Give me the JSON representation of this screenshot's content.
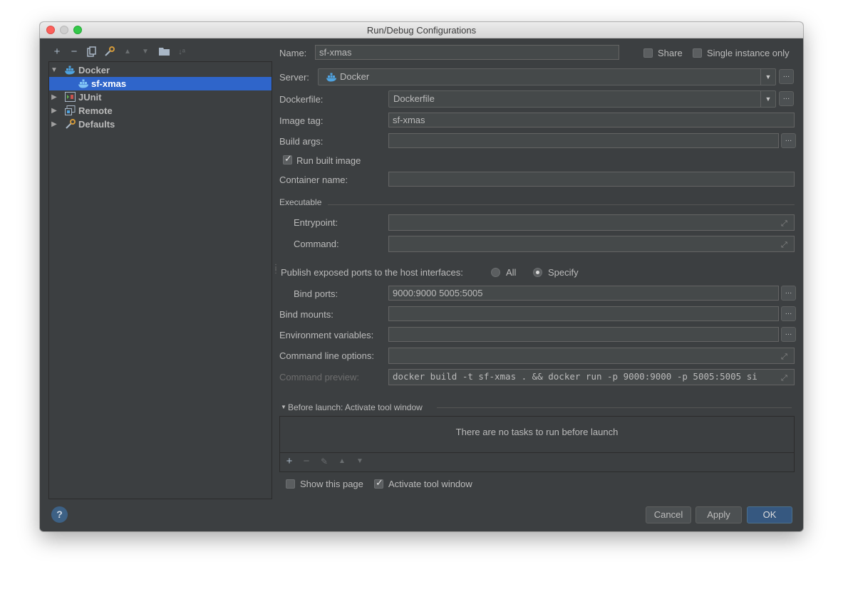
{
  "window": {
    "title": "Run/Debug Configurations"
  },
  "toolbar": {
    "icons": [
      "add-icon",
      "remove-icon",
      "copy-icon",
      "edit-defaults-icon",
      "move-up-icon",
      "move-down-icon",
      "folder-icon",
      "sort-icon"
    ]
  },
  "tree": {
    "items": [
      {
        "label": "Docker",
        "icon": "docker-icon",
        "expanded": true
      },
      {
        "label": "sf-xmas",
        "icon": "docker-icon",
        "selected": true
      },
      {
        "label": "JUnit",
        "icon": "junit-icon",
        "expanded": false
      },
      {
        "label": "Remote",
        "icon": "remote-icon",
        "expanded": false
      },
      {
        "label": "Defaults",
        "icon": "defaults-icon",
        "expanded": false
      }
    ]
  },
  "form": {
    "name_label": "Name:",
    "name_value": "sf-xmas",
    "share_label": "Share",
    "single_instance_label": "Single instance only",
    "server_label": "Server:",
    "server_value": "Docker",
    "dockerfile_label": "Dockerfile:",
    "dockerfile_value": "Dockerfile",
    "image_tag_label": "Image tag:",
    "image_tag_value": "sf-xmas",
    "build_args_label": "Build args:",
    "build_args_value": "",
    "run_built_image_label": "Run built image",
    "run_built_image_checked": true,
    "container_name_label": "Container name:",
    "container_name_value": "",
    "executable_label": "Executable",
    "entrypoint_label": "Entrypoint:",
    "entrypoint_value": "",
    "command_label": "Command:",
    "command_value": "",
    "publish_label": "Publish exposed ports to the host interfaces:",
    "publish_all_label": "All",
    "publish_specify_label": "Specify",
    "publish_selected": "Specify",
    "bind_ports_label": "Bind ports:",
    "bind_ports_value": "9000:9000 5005:5005",
    "bind_mounts_label": "Bind mounts:",
    "bind_mounts_value": "",
    "env_vars_label": "Environment variables:",
    "env_vars_value": "",
    "cmd_options_label": "Command line options:",
    "cmd_options_value": "",
    "cmd_preview_label": "Command preview:",
    "cmd_preview_value": "docker build -t sf-xmas . && docker run -p 9000:9000 -p 5005:5005 si"
  },
  "before_launch": {
    "header": "Before launch: Activate tool window",
    "empty_text": "There are no tasks to run before launch",
    "show_page_label": "Show this page",
    "show_page_checked": false,
    "activate_label": "Activate tool window",
    "activate_checked": true
  },
  "buttons": {
    "help": "?",
    "cancel": "Cancel",
    "apply": "Apply",
    "ok": "OK"
  },
  "colors": {
    "background": "#3c3f41",
    "selection": "#2f65ca",
    "field": "#45494a",
    "primary_button": "#365880"
  }
}
